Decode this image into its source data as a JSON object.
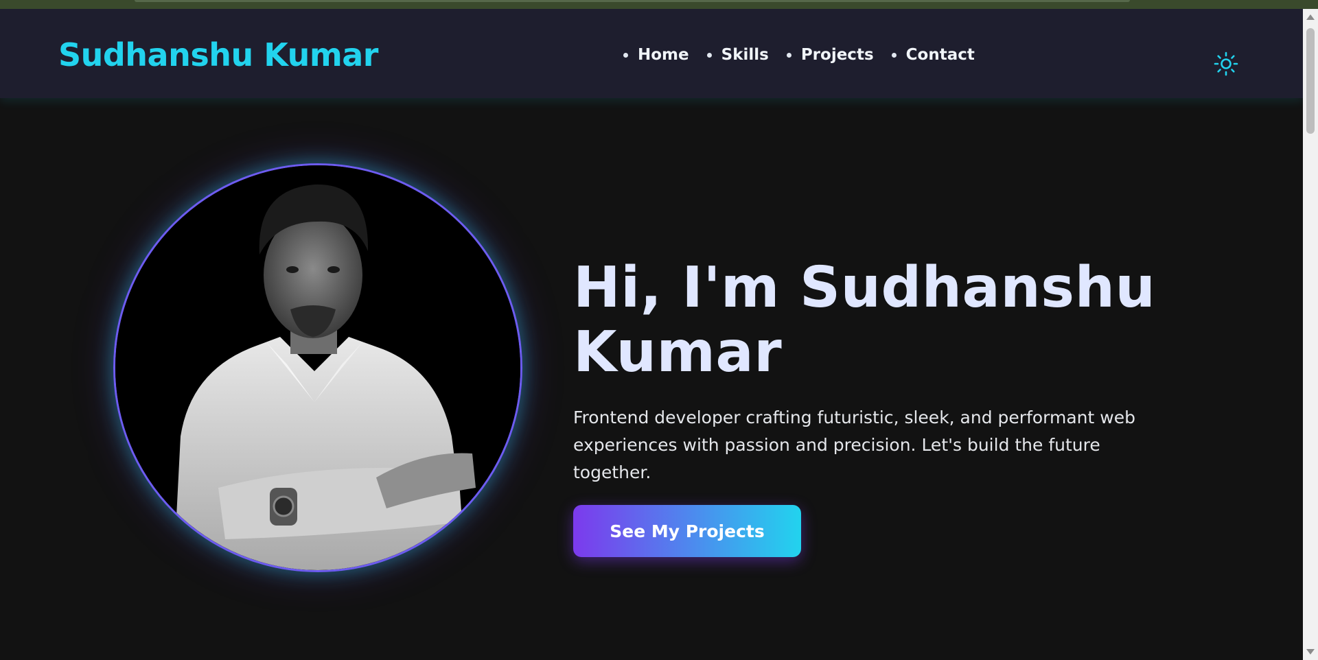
{
  "colors": {
    "accent": "#22d3ee",
    "gradient_start": "#7c3aed",
    "gradient_end": "#22d3ee",
    "background": "#121212",
    "navbar": "#1e1e2e",
    "title": "#e0e7ff"
  },
  "header": {
    "brand": "Sudhanshu Kumar",
    "nav_items": [
      {
        "label": "Home"
      },
      {
        "label": "Skills"
      },
      {
        "label": "Projects"
      },
      {
        "label": "Contact"
      }
    ],
    "theme_toggle_icon": "sun-icon"
  },
  "hero": {
    "photo_icon": "profile-photo",
    "title": "Hi, I'm Sudhanshu Kumar",
    "description": "Frontend developer crafting futuristic, sleek, and performant web experiences with passion and precision. Let's build the future together.",
    "cta_label": "See My Projects"
  }
}
